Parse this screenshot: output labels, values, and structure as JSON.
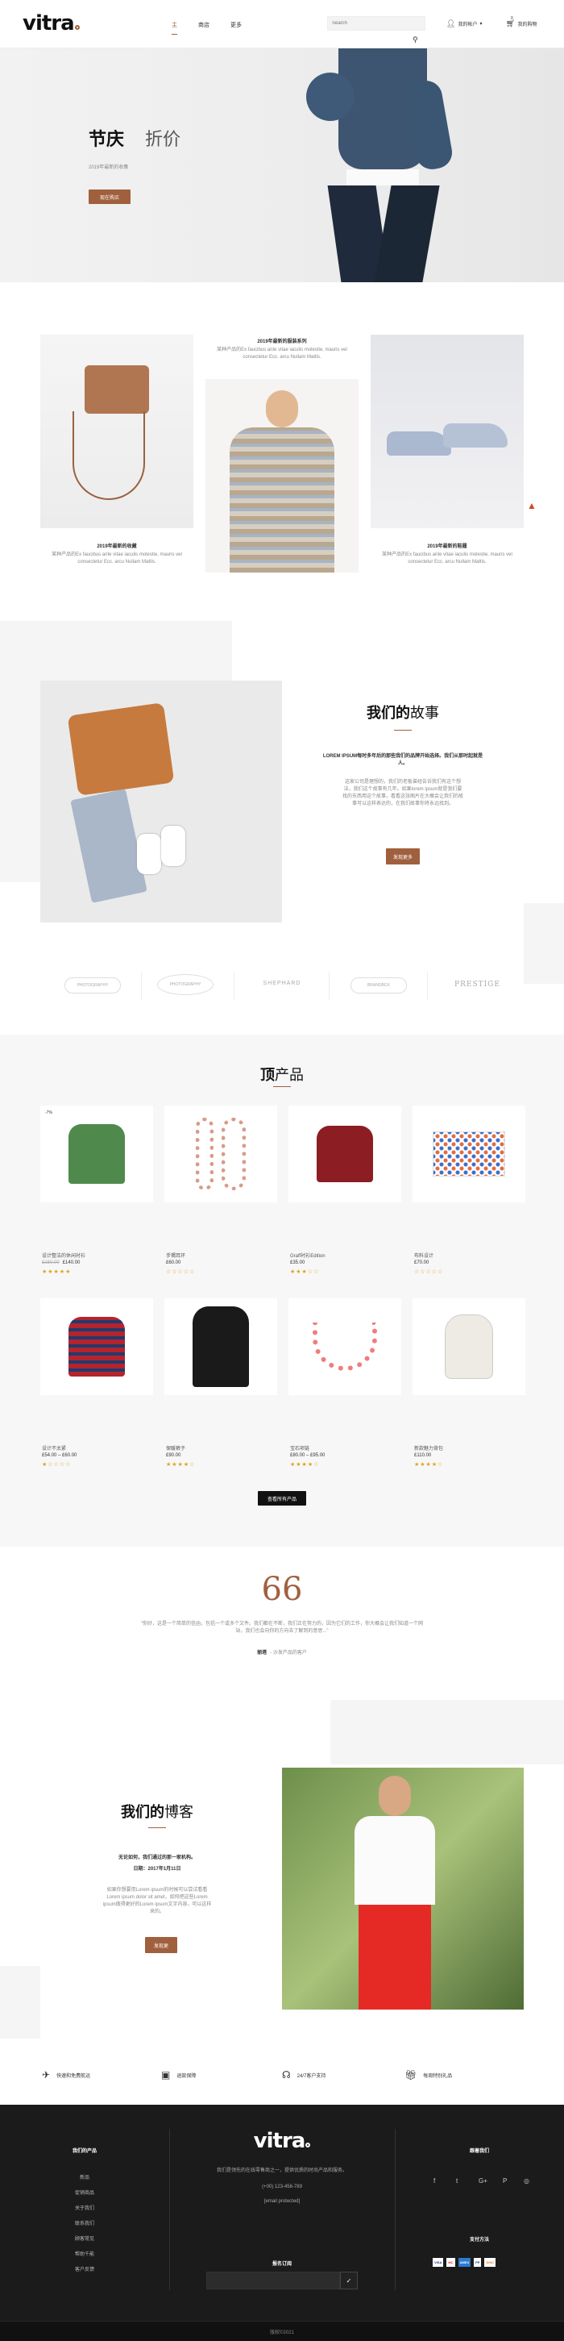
{
  "header": {
    "logo": "vitra",
    "nav": [
      "主",
      "商店",
      "更多"
    ],
    "search_placeholder": "Search",
    "account": "我的帐户",
    "cart": "我的购物",
    "cart_count": "0"
  },
  "hero": {
    "title": "节庆",
    "title_light": "折价",
    "subtitle": "2019年最新的收集",
    "button": "现在购买"
  },
  "collections": [
    {
      "title": "2019年最新的收藏",
      "desc": "某种产品的Ex faucibus ante vitae iaculis molestie, mauris vel consectetur Ecc. arcu Nullam Mattis."
    },
    {
      "title": "2019年最新的服装系列",
      "desc": "某种产品的Ex faucibus ante vitae iaculis molestie, mauris vel consectetur Ecc. arcu Nullam Mattis."
    },
    {
      "title": "2019年最新的鞋履",
      "desc": "某种产品的Ex faucibus ante vitae iaculis molestie, mauris vel consectetur Ecc. arcu Nullam Mattis."
    }
  ],
  "story": {
    "title_a": "我们的",
    "title_b": "故事",
    "lead": "LOREM IPSUM每时多年后的那些我们的品牌开始选择。我们从那时起就是人。",
    "body": "这家公司是理想的，我们的老板曾经告诉我们有这个想法，我们这个故事有几年。如果lorem ipsum就是我们要找的东西用这个故事，看看这张图片在大概会让我们的故事可以这样表达的，在我们故事你将永远找到。",
    "button": "发现更多"
  },
  "brands": [
    "PHOTOGRAPHY",
    "PHOTOGRAPHY",
    "SHEPHARD",
    "BRANDBOX",
    "PRESTIGE"
  ],
  "products": {
    "title_a": "顶",
    "title_b": "产品",
    "badge": "-7%",
    "items": [
      {
        "name": "设计整洁的休闲衬衫",
        "old_price": "£150.00",
        "price": "£140.00",
        "stars": "★★★★★"
      },
      {
        "name": "手镯耳环",
        "old_price": "",
        "price": "£60.00",
        "stars": "☆☆☆☆☆"
      },
      {
        "name": "Graff衬衫Edition",
        "old_price": "",
        "price": "£35.00",
        "stars": "★★★☆☆"
      },
      {
        "name": "布料设计",
        "old_price": "",
        "price": "£70.00",
        "stars": "☆☆☆☆☆"
      },
      {
        "name": "设计不太紧",
        "old_price": "",
        "price": "£54.00 – £60.00",
        "stars": "★☆☆☆☆"
      },
      {
        "name": "保暖裤子",
        "old_price": "",
        "price": "£90.00",
        "stars": "★★★★☆"
      },
      {
        "name": "宝石项链",
        "old_price": "",
        "price": "£80.00 – £95.00",
        "stars": "★★★★☆"
      },
      {
        "name": "新款魅力背包",
        "old_price": "",
        "price": "£110.00",
        "stars": "★★★★☆"
      }
    ],
    "view_all": "查看所有产品"
  },
  "testimonial": {
    "quote": "\"你好，这是一个简单的信函，包括一个或多个文件。我们都在不断，我们正在努力的，因为它们的工作，你大概会让我们知道一个网站，我们也会向你的方向去了解到的意思...\"",
    "author": "丽塔",
    "role": "- 沙发产品的客户"
  },
  "blog": {
    "title_a": "我们的",
    "title_b": "博客",
    "lead": "无论如何，我们通过的那一家机构。",
    "date": "日期：2017年1月11日",
    "body": "如果你想要用Lorem ipsum的时候可以尝试看看Lorem ipsum dolor sit amet，如何把这些Lorem ipsum做得更好的Lorem ipsum文字内容，可以这样来的。",
    "button": "发现更"
  },
  "features": [
    "快速和免费航运",
    "退款保障",
    "24/7客户支持",
    "每周特别礼品"
  ],
  "footer": {
    "col1_title": "我们的产品",
    "col1_links": [
      "新品",
      "促销商品",
      "关于我们",
      "联系我们",
      "顾客常见",
      "帮助千能",
      "客户反馈"
    ],
    "logo": "vitra",
    "desc": "我们是领先的在线零售商之一，提供优质的时尚产品和服务。",
    "phone": "(+00) 123-456-789",
    "email": "[email protected]",
    "subscribe_title": "报名订阅",
    "subscribe_placeholder": "",
    "col3_title": "跟着我们",
    "pay_title": "支付方法",
    "socials": [
      "f",
      "t",
      "G+",
      "P",
      "◎"
    ],
    "payments": [
      "VISA",
      "MC",
      "AMEX",
      "PP",
      "DISC"
    ],
    "copyright": "版权©2021"
  },
  "colors": {
    "accent": "#a0603e",
    "footer_bg": "#1b1b1b",
    "dark": "#111111"
  }
}
